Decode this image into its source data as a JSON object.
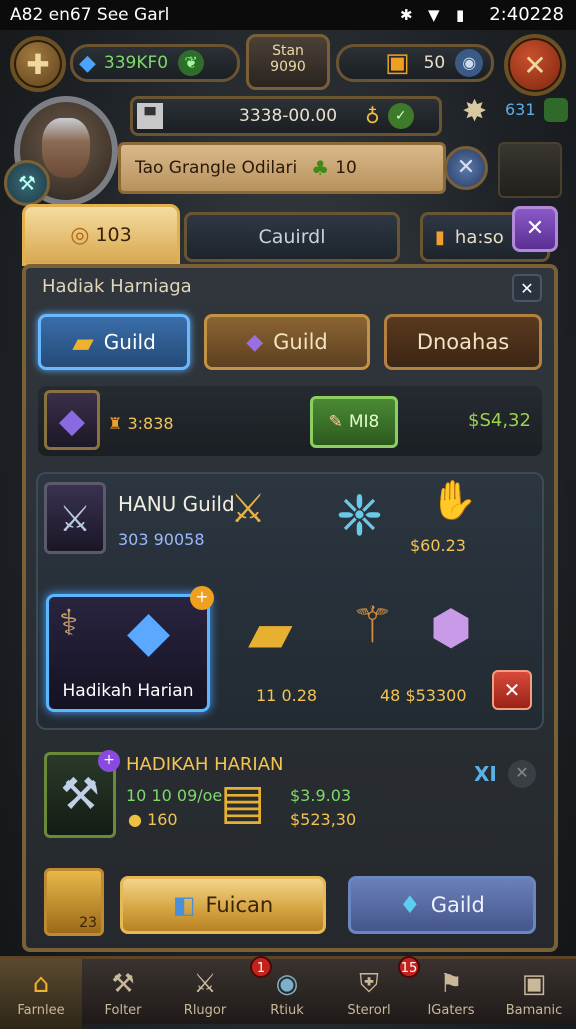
{
  "status_bar": {
    "left_text": "A82 en67 See Garl",
    "time": "2:40228"
  },
  "top_bar": {
    "gem_amount": "339KF0",
    "center_label_top": "Stan",
    "center_label_bottom": "9090",
    "box_amount": "50",
    "icons": [
      "home-icon",
      "gem-icon",
      "plant-icon",
      "chest-icon",
      "globe-icon",
      "close-icon"
    ]
  },
  "player": {
    "currency": "3338-00.00",
    "guild_name": "Tao Grangle Odilari",
    "guild_points": "10",
    "right_counter": "631"
  },
  "tabs_row": {
    "tab1_label": "103",
    "tab2_label": "Cauirdl",
    "tab3_label": "ha:so"
  },
  "dialog": {
    "title": "Hadiak Harniaga",
    "category_tabs": [
      "Guild",
      "Guild",
      "Dnoahas"
    ],
    "summary_row": {
      "item_price": "3:838",
      "button_label": "MI8",
      "total": "$S4,32"
    },
    "featured": {
      "title": "HANU Guild",
      "price": "3 9 0 0 5 8",
      "price_display": "303 90058",
      "item_price": "$60.23",
      "card_label": "Hadikah Harian",
      "row_price_1": "11 0.28",
      "row_price_2": "48 $53300"
    },
    "daily": {
      "title": "HADIKAH HARIAN",
      "close_mark": "XI",
      "line1": "10 10 09/oe",
      "line1_price": "$3.9.03",
      "line2": "160",
      "line2_price": "$523,30"
    },
    "footer": {
      "slot_count": "23",
      "buy_label": "Fuican",
      "guild_label": "Gaild"
    }
  },
  "bottom_nav": [
    {
      "label": "Farnlee",
      "icon": "house-icon"
    },
    {
      "label": "Folter",
      "icon": "anvil-icon"
    },
    {
      "label": "Rlugor",
      "icon": "sword-icon"
    },
    {
      "label": "Rtiuk",
      "icon": "orb-icon",
      "badge": "1"
    },
    {
      "label": "Sterorl",
      "icon": "shield-icon",
      "badge": "15"
    },
    {
      "label": "IGaters",
      "icon": "flag-icon"
    },
    {
      "label": "Bamanic",
      "icon": "chat-icon"
    }
  ]
}
